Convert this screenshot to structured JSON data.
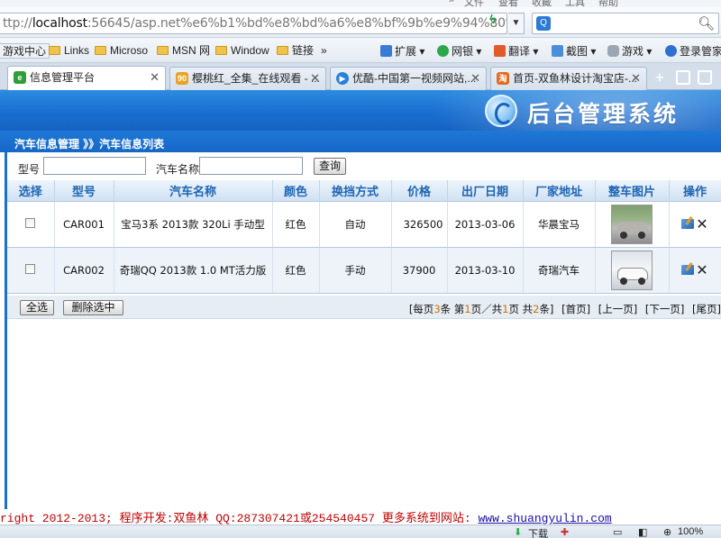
{
  "browser": {
    "menu": [
      "文件",
      "查看",
      "收藏",
      "工具",
      "帮助"
    ],
    "url_host": "localhost",
    "url_prefix": "ttp://",
    "url_rest": ":56645/asp.net%e6%b1%bd%e8%bd%a6%e8%bf%9b%e9%94%80%e",
    "favorites": [
      "游戏中心",
      "Links",
      "Microso",
      "MSN 网",
      "Window",
      "链接"
    ],
    "more_glyph": "»",
    "tools": [
      "扩展",
      "网银",
      "翻译",
      "截图",
      "游戏",
      "登录管家"
    ],
    "tabs": [
      {
        "title": "信息管理平台",
        "active": true,
        "icon_color": "#2e9d3a",
        "icon_text": "e"
      },
      {
        "title": "樱桃红_全集_在线观看 - ...",
        "active": false,
        "icon_color": "#e8a323",
        "icon_text": "90"
      },
      {
        "title": "优酷-中国第一视频网站,...",
        "active": false,
        "icon_color": "#2a7fd8",
        "icon_text": "▶"
      },
      {
        "title": "首页-双鱼林设计淘宝店-...",
        "active": false,
        "icon_color": "#e56a1f",
        "icon_text": "淘"
      }
    ],
    "status": {
      "download": "下载",
      "zoom": "100%"
    }
  },
  "page": {
    "banner_title": "后台管理系统",
    "breadcrumb": "汽车信息管理 》》汽车信息列表",
    "filter": {
      "model_label": "型号",
      "name_label": "汽车名称",
      "query_button": "查询"
    },
    "table": {
      "headers": [
        "选择",
        "型号",
        "汽车名称",
        "颜色",
        "换挡方式",
        "价格",
        "出厂日期",
        "厂家地址",
        "整车图片",
        "操作"
      ],
      "rows": [
        {
          "model": "CAR001",
          "name": "宝马3系 2013款 320Li 手动型",
          "color": "红色",
          "gear": "自动",
          "price": "326500",
          "date": "2013-03-06",
          "maker": "华晨宝马",
          "image": "car-photo-gray-sedan"
        },
        {
          "model": "CAR002",
          "name": "奇瑞QQ 2013款 1.0 MT活力版",
          "color": "红色",
          "gear": "手动",
          "price": "37900",
          "date": "2013-03-10",
          "maker": "奇瑞汽车",
          "image": "car-photo-white-hatchback"
        }
      ]
    },
    "actions": {
      "select_all": "全选",
      "delete_selected": "删除选中"
    },
    "pager": {
      "per_page_prefix": "[每页",
      "per_page": "3",
      "per_page_suffix": "条 第",
      "current": "1",
      "mid": "页／共",
      "pages": "1",
      "total_prefix": "页 共",
      "total": "2",
      "total_suffix": "条]",
      "first": "[首页]",
      "prev": "[上一页]",
      "next": "[下一页]",
      "last": "[尾页]"
    },
    "footer": {
      "copyright": "right 2012-2013; 程序开发:双鱼林  QQ:287307421或254540457  更多系统到网站: ",
      "site": "www.shuangyulin.com"
    }
  }
}
